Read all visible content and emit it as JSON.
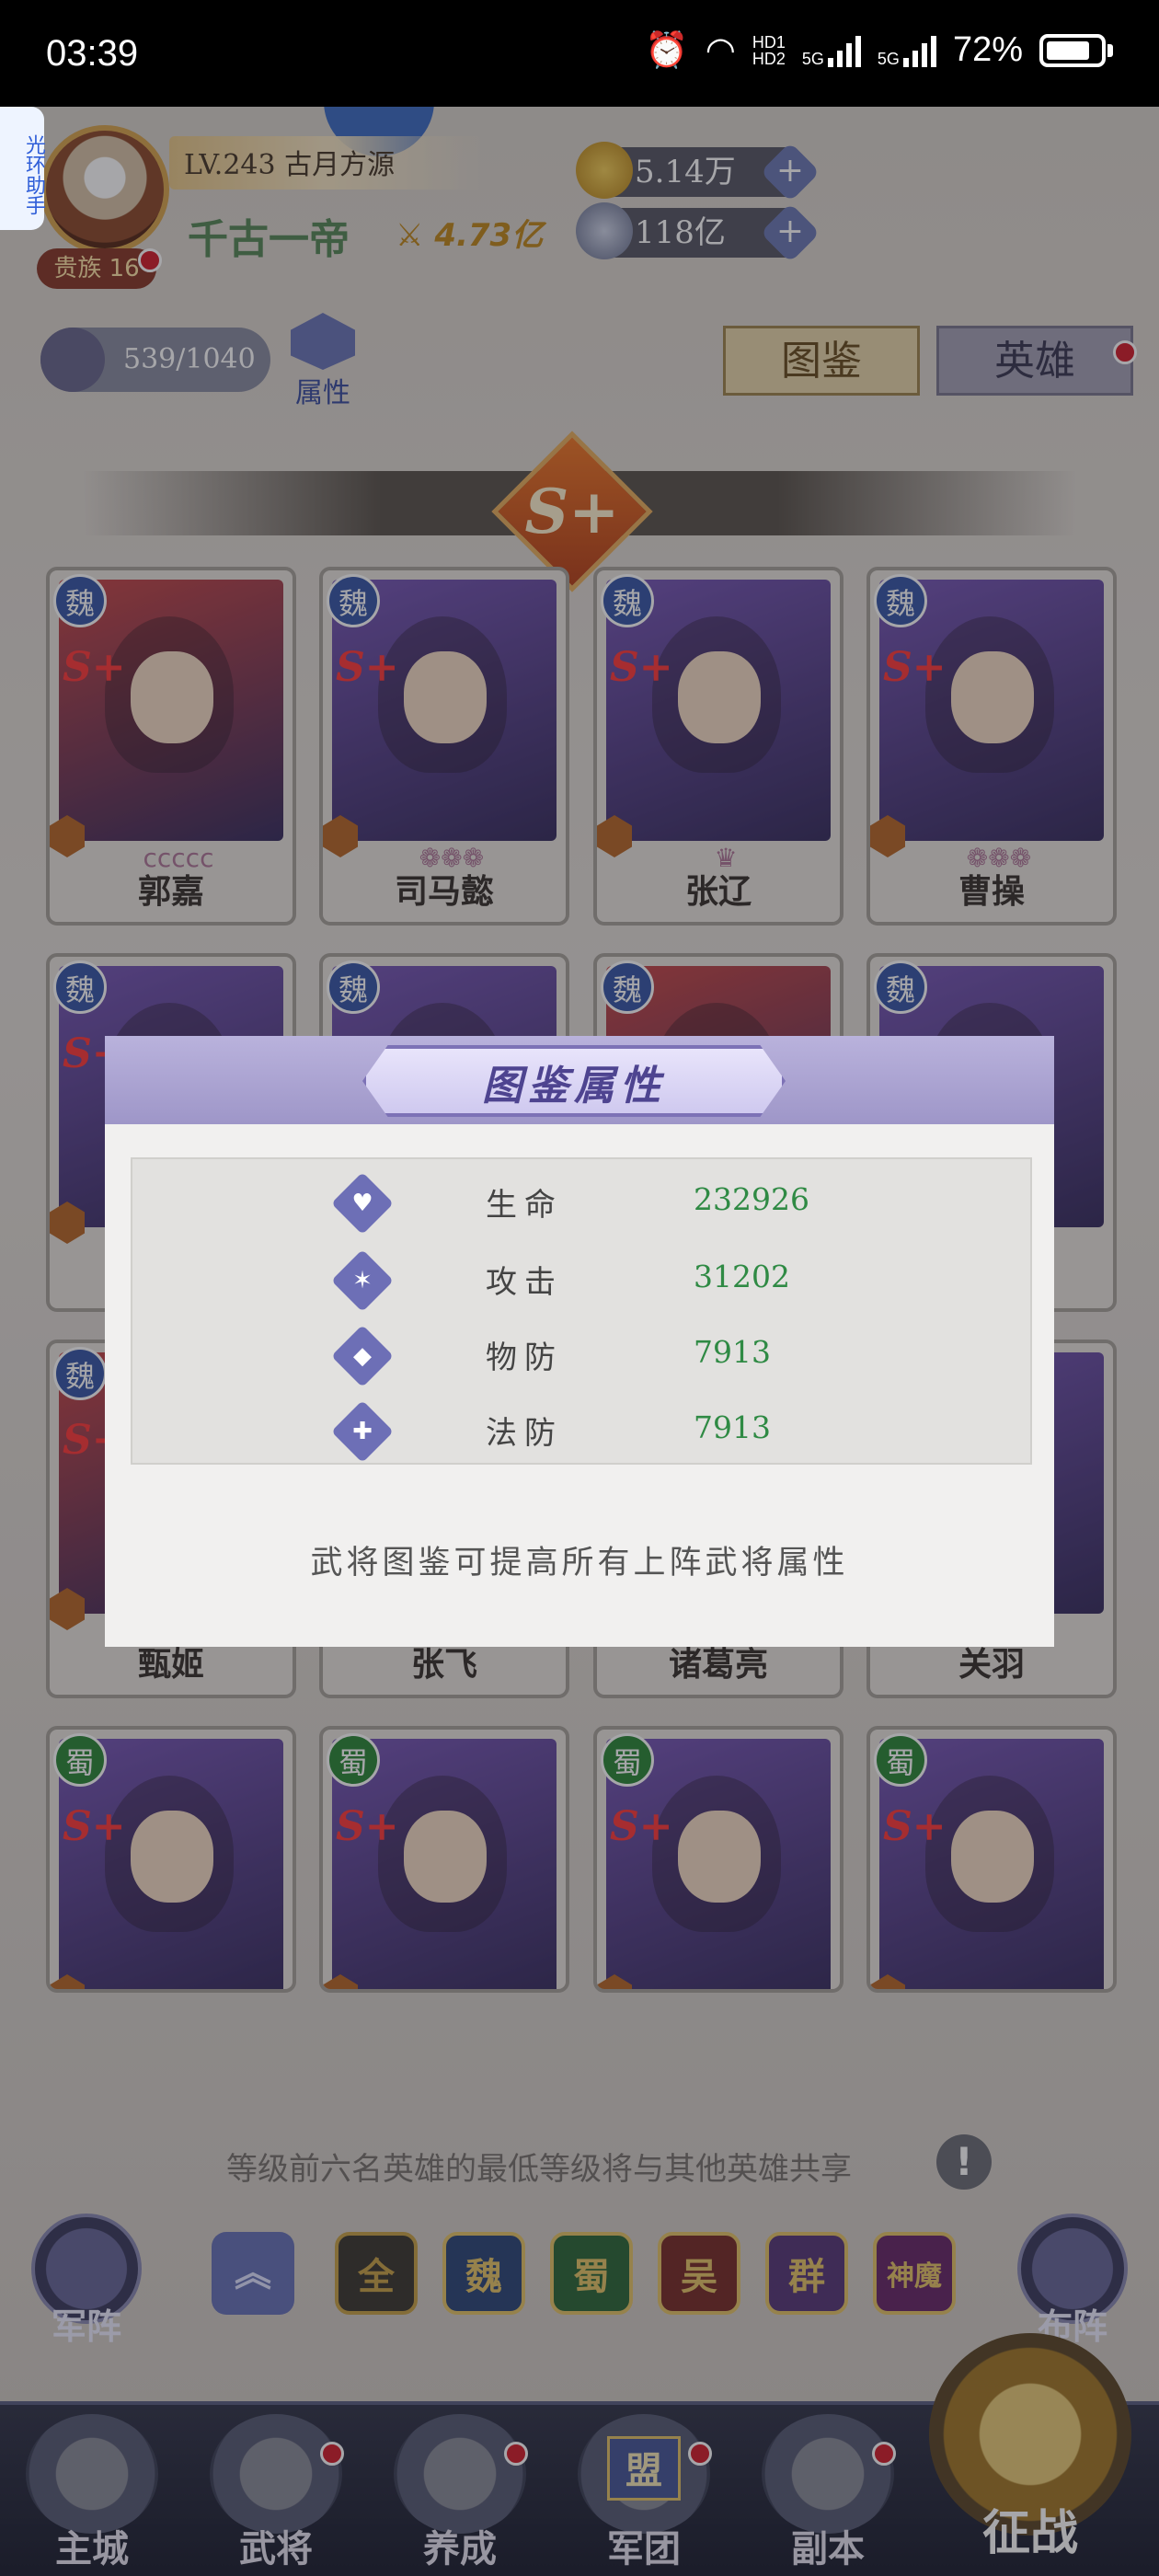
{
  "status_bar": {
    "time": "03:39",
    "hd_label_1": "HD1",
    "hd_label_2": "HD2",
    "net_1": "5G",
    "net_2": "5G",
    "battery": "72%"
  },
  "assistant_tab": "光环助手",
  "player": {
    "level": "LV.243 古月方源",
    "name": "千古一帝",
    "power": "4.73亿",
    "noble": "贵族 16",
    "gold": "5.14万",
    "silver": "118亿"
  },
  "collection": {
    "count": "539/1040",
    "attr_label": "属性",
    "tabs": [
      {
        "label": "图鉴",
        "active": true
      },
      {
        "label": "英雄",
        "active": false
      }
    ],
    "rank": "S+"
  },
  "heroes": [
    {
      "kingdom": "魏",
      "name": "郭嘉",
      "stars": "ccccc",
      "color": "#c94a4a"
    },
    {
      "kingdom": "魏",
      "name": "司马懿",
      "stars": "❁❁❁",
      "color": "#7a5ab8"
    },
    {
      "kingdom": "魏",
      "name": "张辽",
      "stars": "♛",
      "color": "#7a5ab8"
    },
    {
      "kingdom": "魏",
      "name": "曹操",
      "stars": "❁❁❁",
      "color": "#7a5ab8"
    },
    {
      "kingdom": "魏",
      "name": "",
      "stars": "",
      "color": "#7a5ab8"
    },
    {
      "kingdom": "魏",
      "name": "",
      "stars": "",
      "color": "#7a5ab8"
    },
    {
      "kingdom": "魏",
      "name": "",
      "stars": "",
      "color": "#c94a4a"
    },
    {
      "kingdom": "魏",
      "name": "",
      "stars": "",
      "color": "#7a5ab8"
    },
    {
      "kingdom": "魏",
      "name": "甄姬",
      "stars": "",
      "color": "#c94a4a"
    },
    {
      "kingdom": "",
      "name": "张飞",
      "stars": "",
      "color": "#7a5ab8"
    },
    {
      "kingdom": "",
      "name": "诸葛亮",
      "stars": "",
      "color": "#7a5ab8"
    },
    {
      "kingdom": "",
      "name": "关羽",
      "stars": "",
      "color": "#7a5ab8"
    },
    {
      "kingdom": "蜀",
      "name": "",
      "stars": "",
      "color": "#7a5ab8"
    },
    {
      "kingdom": "蜀",
      "name": "",
      "stars": "",
      "color": "#7a5ab8"
    },
    {
      "kingdom": "蜀",
      "name": "",
      "stars": "",
      "color": "#7a5ab8"
    },
    {
      "kingdom": "蜀",
      "name": "",
      "stars": "",
      "color": "#7a5ab8"
    }
  ],
  "notice": "等级前六名英雄的最低等级将与其他英雄共享",
  "side_buttons": {
    "left": "军阵",
    "right": "布阵"
  },
  "filters": [
    {
      "label": "全",
      "color": "#c9a44a",
      "bg": "#3e3a32"
    },
    {
      "label": "魏",
      "color": "#e6c66a",
      "bg": "#2f4a7a"
    },
    {
      "label": "蜀",
      "color": "#e6c66a",
      "bg": "#2f6a3a"
    },
    {
      "label": "吴",
      "color": "#e6c66a",
      "bg": "#7a2f2a"
    },
    {
      "label": "群",
      "color": "#e6c66a",
      "bg": "#5a3a7a"
    },
    {
      "label": "神魔",
      "color": "#e6c66a",
      "bg": "#6a2a6a"
    }
  ],
  "bottom_nav": [
    {
      "label": "主城"
    },
    {
      "label": "武将"
    },
    {
      "label": "养成"
    },
    {
      "label": "军团",
      "sub": "盟"
    },
    {
      "label": "副本"
    }
  ],
  "bottom_nav_main": "征战",
  "modal": {
    "title": "图鉴属性",
    "stats": [
      {
        "icon": "♥",
        "name": "生命",
        "value": "232926"
      },
      {
        "icon": "✶",
        "name": "攻击",
        "value": "31202"
      },
      {
        "icon": "◆",
        "name": "物防",
        "value": "7913"
      },
      {
        "icon": "✚",
        "name": "法防",
        "value": "7913"
      }
    ],
    "note": "武将图鉴可提高所有上阵武将属性"
  }
}
